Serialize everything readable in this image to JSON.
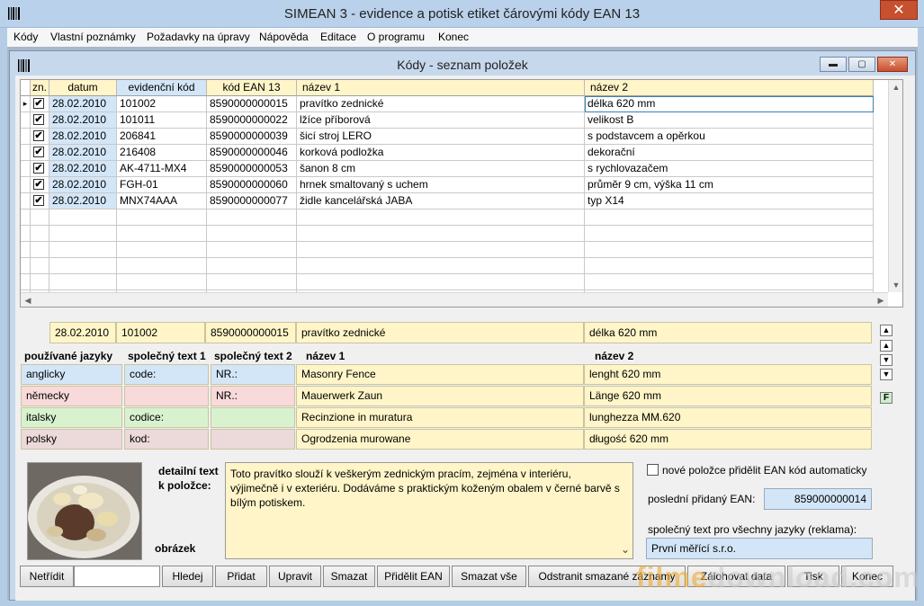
{
  "window": {
    "title": "SIMEAN 3 - evidence a potisk etiket čárovými kódy EAN 13",
    "close_glyph": "✕"
  },
  "menu": [
    {
      "label": "Kódy"
    },
    {
      "label": "Vlastní poznámky"
    },
    {
      "label": "Požadavky na úpravy"
    },
    {
      "label": "Nápověda"
    },
    {
      "label": "Editace"
    },
    {
      "label": "O programu"
    },
    {
      "label": "Konec"
    }
  ],
  "child": {
    "title": "Kódy - seznam položek",
    "min_glyph": "▬",
    "max_glyph": "▢",
    "close_glyph": "✕"
  },
  "grid": {
    "headers": [
      "zn.",
      "datum",
      "evidenční kód",
      "kód EAN 13",
      "název 1",
      "název 2"
    ],
    "rows": [
      {
        "checked": true,
        "datum": "28.02.2010",
        "kod": "101002",
        "ean": "8590000000015",
        "nazev1": "pravítko zednické",
        "nazev2": "délka 620 mm"
      },
      {
        "checked": true,
        "datum": "28.02.2010",
        "kod": "101011",
        "ean": "8590000000022",
        "nazev1": "lžíce příborová",
        "nazev2": "velikost B"
      },
      {
        "checked": true,
        "datum": "28.02.2010",
        "kod": "206841",
        "ean": "8590000000039",
        "nazev1": "šicí stroj LERO",
        "nazev2": "s podstavcem a opěrkou"
      },
      {
        "checked": true,
        "datum": "28.02.2010",
        "kod": "216408",
        "ean": "8590000000046",
        "nazev1": "korková podložka",
        "nazev2": "dekorační"
      },
      {
        "checked": true,
        "datum": "28.02.2010",
        "kod": "AK-4711-MX4",
        "ean": "8590000000053",
        "nazev1": "šanon 8 cm",
        "nazev2": "s rychlovazačem"
      },
      {
        "checked": true,
        "datum": "28.02.2010",
        "kod": "FGH-01",
        "ean": "8590000000060",
        "nazev1": "hrnek smaltovaný s uchem",
        "nazev2": "průměr 9 cm, výška 11 cm"
      },
      {
        "checked": true,
        "datum": "28.02.2010",
        "kod": "MNX74AAA",
        "ean": "8590000000077",
        "nazev1": "židle kancelářská JABA",
        "nazev2": "typ X14"
      }
    ],
    "check_glyph": "✔",
    "row_pointer_glyph": "▸"
  },
  "selected": {
    "datum": "28.02.2010",
    "kod": "101002",
    "ean": "8590000000015",
    "nazev1": "pravítko zednické",
    "nazev2": "délka 620 mm"
  },
  "nav": {
    "first": "▲",
    "prev": "▲",
    "next": "▼",
    "last": "▼",
    "f_label": "F"
  },
  "languages": {
    "headers": [
      "používané jazyky",
      "společný text 1",
      "společný text 2",
      "název 1",
      "název 2"
    ],
    "rows": [
      {
        "lang": "anglicky",
        "t1": "code:",
        "t2": "NR.:",
        "n1": "Masonry Fence",
        "n2": "lenght 620 mm",
        "color": "#d3e6f8"
      },
      {
        "lang": "německy",
        "t1": "",
        "t2": "NR.:",
        "n1": "Mauerwerk Zaun",
        "n2": "Länge 620 mm",
        "color": "#f8dada"
      },
      {
        "lang": "italsky",
        "t1": "codice:",
        "t2": "",
        "n1": "Recinzione in muratura",
        "n2": "lunghezza MM.620",
        "color": "#d8f2cf"
      },
      {
        "lang": "polsky",
        "t1": "kod:",
        "t2": "",
        "n1": "Ogrodzenia murowane",
        "n2": "długość 620 mm",
        "color": "#ecd9d9"
      }
    ]
  },
  "bottom": {
    "detail_label_1": "detailní text",
    "detail_label_2": "k položce:",
    "image_label": "obrázek",
    "detail_text": "Toto pravítko slouží k veškerým zednickým pracím, zejména v interiéru, výjimečně i v exteriéru. Dodáváme s praktickým koženým obalem v černé barvě s bílým potiskem.",
    "auto_ean_label": "nové položce přidělit EAN kód automaticky",
    "auto_ean_checked": false,
    "last_ean_label": "poslední přidaný EAN:",
    "last_ean_value": "859000000014",
    "common_text_label": "společný text pro všechny jazyky (reklama):",
    "common_text_value": "První měřící s.r.o."
  },
  "buttons": [
    "Netřídit",
    "Hledej",
    "Přidat",
    "Upravit",
    "Smazat",
    "Přidělit EAN",
    "Smazat vše",
    "Odstranit smazané záznamy",
    "Zálohovat data",
    "Tisk",
    "Konec"
  ],
  "search_value": "",
  "watermark": {
    "part1": "filme",
    "part2": "download.com"
  },
  "icons": {
    "app": "barcode-icon",
    "child": "barcode-icon",
    "scroll_up": "▲",
    "scroll_down": "▼",
    "scroll_left": "◀",
    "scroll_right": "▶",
    "text_scroll": "⌄"
  }
}
